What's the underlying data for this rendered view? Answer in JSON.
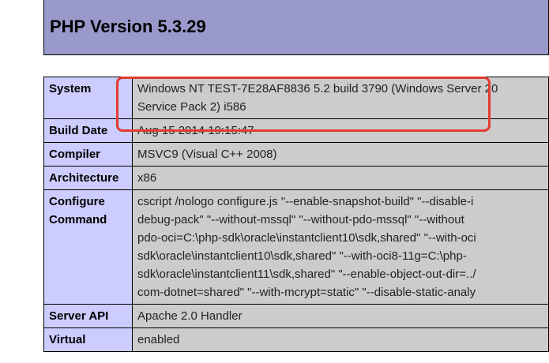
{
  "header": {
    "title": "PHP Version 5.3.29"
  },
  "rows": [
    {
      "label": "System",
      "lines": [
        "Windows NT TEST-7E28AF8836 5.2 build 3790 (Windows Server 20",
        "Service Pack 2) i586"
      ]
    },
    {
      "label": "Build Date",
      "lines": [
        "Aug 15 2014 19:15:47"
      ]
    },
    {
      "label": "Compiler",
      "lines": [
        "MSVC9 (Visual C++ 2008)"
      ]
    },
    {
      "label": "Architecture",
      "lines": [
        "x86"
      ]
    },
    {
      "label": "Configure Command",
      "lines": [
        "cscript /nologo configure.js \"--enable-snapshot-build\" \"--disable-i",
        "debug-pack\" \"--without-mssql\" \"--without-pdo-mssql\" \"--without",
        "pdo-oci=C:\\php-sdk\\oracle\\instantclient10\\sdk,shared\" \"--with-oci",
        "sdk\\oracle\\instantclient10\\sdk,shared\" \"--with-oci8-11g=C:\\php-",
        "sdk\\oracle\\instantclient11\\sdk,shared\" \"--enable-object-out-dir=../",
        "com-dotnet=shared\" \"--with-mcrypt=static\" \"--disable-static-analy"
      ]
    },
    {
      "label": "Server API",
      "lines": [
        "Apache 2.0 Handler"
      ]
    },
    {
      "label": "Virtual",
      "lines": [
        "enabled"
      ]
    }
  ],
  "colors": {
    "header": "#9999cc",
    "label_cell": "#ccccff",
    "value_cell": "#cccccc",
    "highlight": "#e33b2f"
  }
}
